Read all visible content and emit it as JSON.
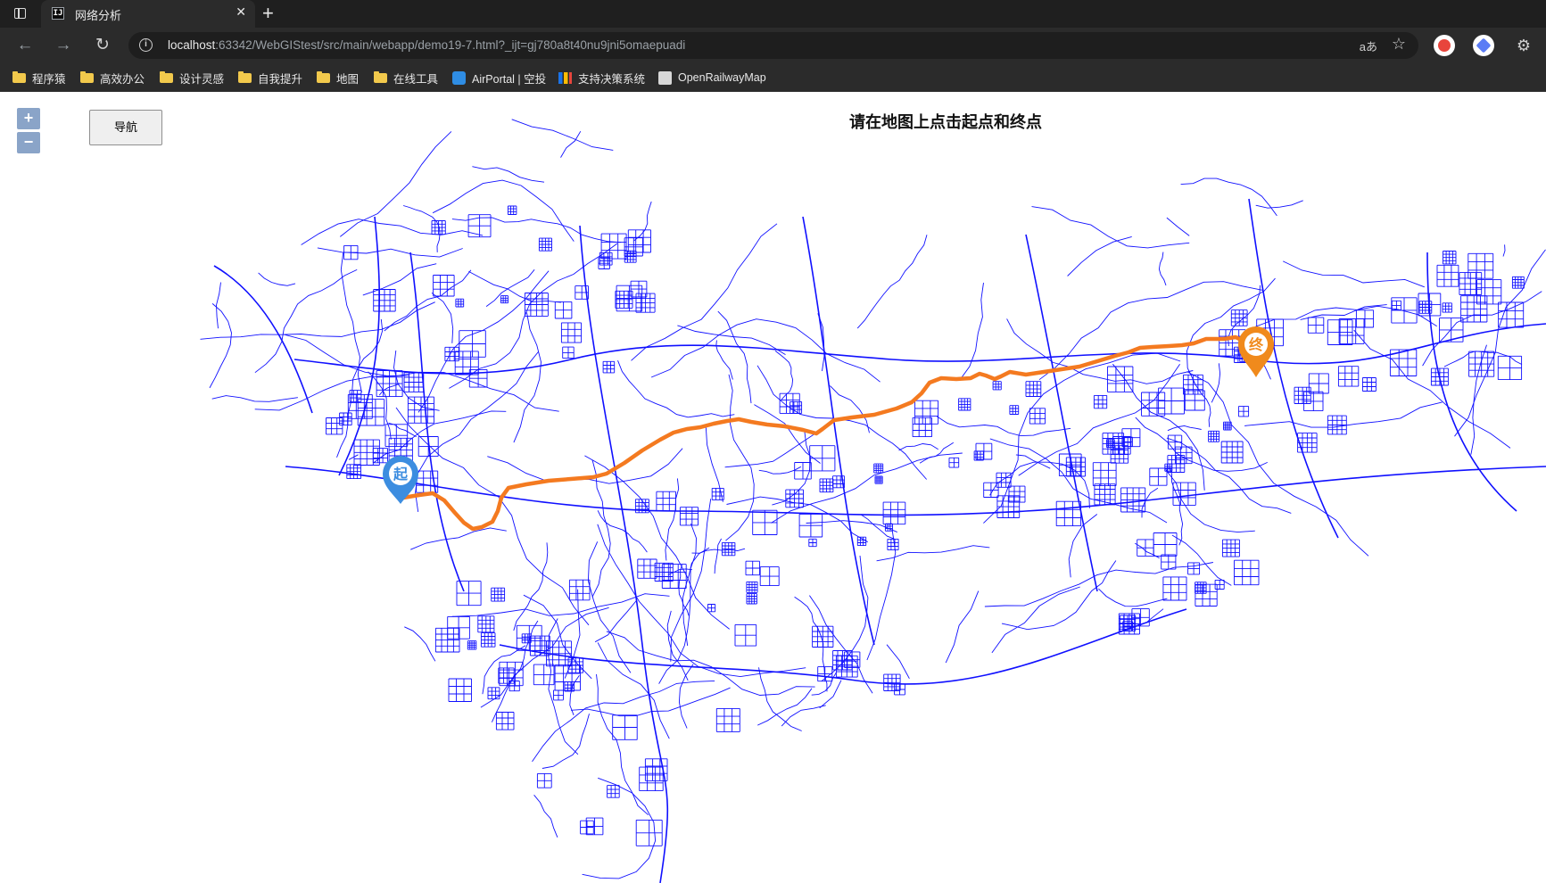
{
  "browser": {
    "tab_title": "网络分析",
    "favicon_text": "IJ",
    "url_host": "localhost",
    "url_rest": ":63342/WebGIStest/src/main/webapp/demo19-7.html?_ijt=gj780a8t40nu9jni5omaepuadi",
    "bookmarks": [
      {
        "label": "程序猿",
        "icon": "folder-icon"
      },
      {
        "label": "高效办公",
        "icon": "folder-icon"
      },
      {
        "label": "设计灵感",
        "icon": "folder-icon"
      },
      {
        "label": "自我提升",
        "icon": "folder-icon"
      },
      {
        "label": "地图",
        "icon": "folder-icon"
      },
      {
        "label": "在线工具",
        "icon": "folder-icon"
      },
      {
        "label": "AirPortal | 空投",
        "icon": "cloud-icon"
      },
      {
        "label": "支持决策系统",
        "icon": "chart-icon"
      },
      {
        "label": "OpenRailwayMap",
        "icon": "rail-icon"
      }
    ]
  },
  "map": {
    "zoom_in": "+",
    "zoom_out": "−",
    "navigate_button": "导航",
    "hint": "请在地图上点击起点和终点",
    "start_marker": "起",
    "end_marker": "终",
    "colors": {
      "road": "#1010ff",
      "route": "#f47a20",
      "start_marker": "#3c8de0",
      "end_marker": "#f08a1c"
    }
  }
}
